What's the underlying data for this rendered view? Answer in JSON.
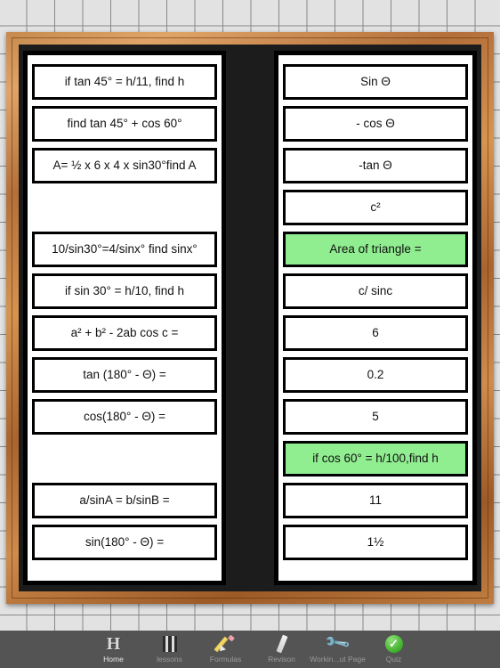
{
  "colors": {
    "board_background": "#1c1c1c",
    "card_highlight_green": "#90ee90",
    "frame_wood": "#c78a4e",
    "tabbar_background": "#545454",
    "page_background": "#e2e2e2"
  },
  "left_column": {
    "name": "questions-column",
    "cards": [
      {
        "text": "if tan 45° = h/11, find h",
        "highlighted": false,
        "empty": false
      },
      {
        "text": "find tan 45° + cos 60°",
        "highlighted": false,
        "empty": false
      },
      {
        "text": "A= ½ x 6 x 4 x sin30°find A",
        "highlighted": false,
        "empty": false
      },
      {
        "text": "",
        "highlighted": false,
        "empty": true
      },
      {
        "text": "10/sin30°=4/sinx° find sinx°",
        "highlighted": false,
        "empty": false
      },
      {
        "text": "if sin 30° = h/10, find h",
        "highlighted": false,
        "empty": false
      },
      {
        "text": "a² + b² - 2ab cos c =",
        "highlighted": false,
        "empty": false
      },
      {
        "text": "tan (180° - Θ) =",
        "highlighted": false,
        "empty": false
      },
      {
        "text": "cos(180° - Θ) =",
        "highlighted": false,
        "empty": false
      },
      {
        "text": "",
        "highlighted": false,
        "empty": true
      },
      {
        "text": "a/sinA = b/sinB =",
        "highlighted": false,
        "empty": false
      },
      {
        "text": "sin(180° - Θ) =",
        "highlighted": false,
        "empty": false
      }
    ]
  },
  "right_column": {
    "name": "answers-column",
    "cards": [
      {
        "text": "Sin Θ",
        "highlighted": false,
        "empty": false
      },
      {
        "text": "- cos Θ",
        "highlighted": false,
        "empty": false
      },
      {
        "text": "-tan Θ",
        "highlighted": false,
        "empty": false
      },
      {
        "text": "c²",
        "highlighted": false,
        "empty": false
      },
      {
        "text": "Area of triangle =",
        "highlighted": true,
        "empty": false
      },
      {
        "text": "c/ sinc",
        "highlighted": false,
        "empty": false
      },
      {
        "text": "6",
        "highlighted": false,
        "empty": false
      },
      {
        "text": "0.2",
        "highlighted": false,
        "empty": false
      },
      {
        "text": "5",
        "highlighted": false,
        "empty": false
      },
      {
        "text": "if cos 60° = h/100,find h",
        "highlighted": true,
        "empty": false
      },
      {
        "text": "11",
        "highlighted": false,
        "empty": false
      },
      {
        "text": "1½",
        "highlighted": false,
        "empty": false
      }
    ]
  },
  "tabbar": {
    "items": [
      {
        "label": "Home",
        "icon": "home-h-icon",
        "active": true
      },
      {
        "label": "lessons",
        "icon": "film-strip-icon",
        "active": false
      },
      {
        "label": "Formulas",
        "icon": "pencil-icon",
        "active": false
      },
      {
        "label": "Revison",
        "icon": "ruler-icon",
        "active": false
      },
      {
        "label": "Workin...ut Page",
        "icon": "wrench-icon",
        "active": false
      },
      {
        "label": "Quiz",
        "icon": "green-check-icon",
        "active": false
      }
    ]
  }
}
